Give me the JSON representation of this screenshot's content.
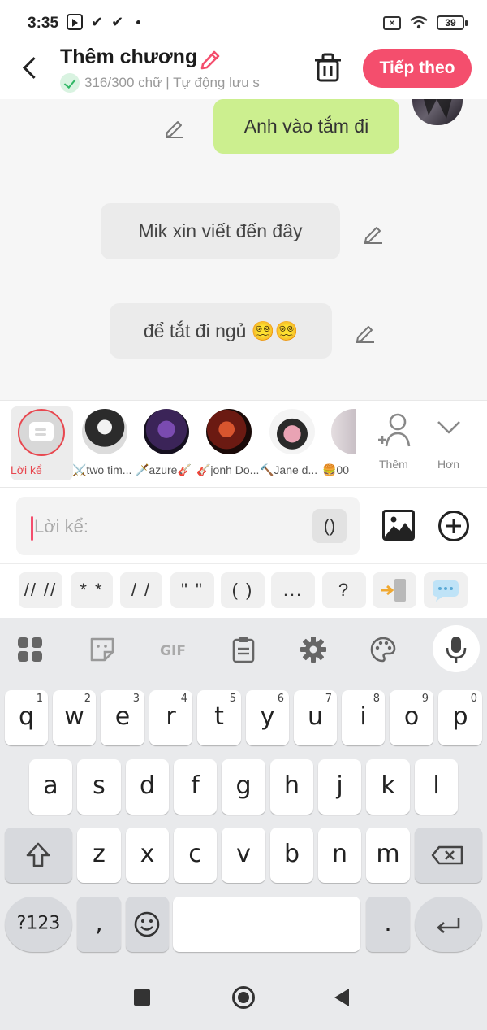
{
  "status_bar": {
    "time": "3:35",
    "battery": "39"
  },
  "header": {
    "title": "Thêm chương",
    "subtitle": "316/300 chữ | Tự động lưu s",
    "next_label": "Tiếp theo"
  },
  "chat": {
    "messages": [
      {
        "text": "Anh vào tắm đi"
      },
      {
        "text": "Mik xin viết đến đây"
      },
      {
        "text": "để tắt đi ngủ 😵‍💫😵‍💫"
      }
    ]
  },
  "characters": {
    "narrator_label": "Lời kể",
    "items": [
      {
        "label": "⚔️two tim..."
      },
      {
        "label": "🗡️azure🎸"
      },
      {
        "label": "🎸jonh Do..."
      },
      {
        "label": "🔨Jane d..."
      },
      {
        "label": "🍔00"
      }
    ],
    "add_label": "Thêm",
    "more_label": "Hơn"
  },
  "input": {
    "placeholder": "Lời kể:",
    "paren_label": "()"
  },
  "symbols": [
    "// //",
    "* *",
    "/ /",
    "\" \"",
    "( )",
    "...",
    "?"
  ],
  "keyboard": {
    "row1": [
      {
        "k": "q",
        "n": "1"
      },
      {
        "k": "w",
        "n": "2"
      },
      {
        "k": "e",
        "n": "3"
      },
      {
        "k": "r",
        "n": "4"
      },
      {
        "k": "t",
        "n": "5"
      },
      {
        "k": "y",
        "n": "6"
      },
      {
        "k": "u",
        "n": "7"
      },
      {
        "k": "i",
        "n": "8"
      },
      {
        "k": "o",
        "n": "9"
      },
      {
        "k": "p",
        "n": "0"
      }
    ],
    "row2": [
      "a",
      "s",
      "d",
      "f",
      "g",
      "h",
      "j",
      "k",
      "l"
    ],
    "row3": [
      "z",
      "x",
      "c",
      "v",
      "b",
      "n",
      "m"
    ],
    "num_label": "?123",
    "comma": ",",
    "period": ".",
    "gif_label": "GIF"
  },
  "colors": {
    "accent": "#f44e6d",
    "green_bubble": "#ccef8f",
    "grey_bubble": "#ebebeb"
  }
}
